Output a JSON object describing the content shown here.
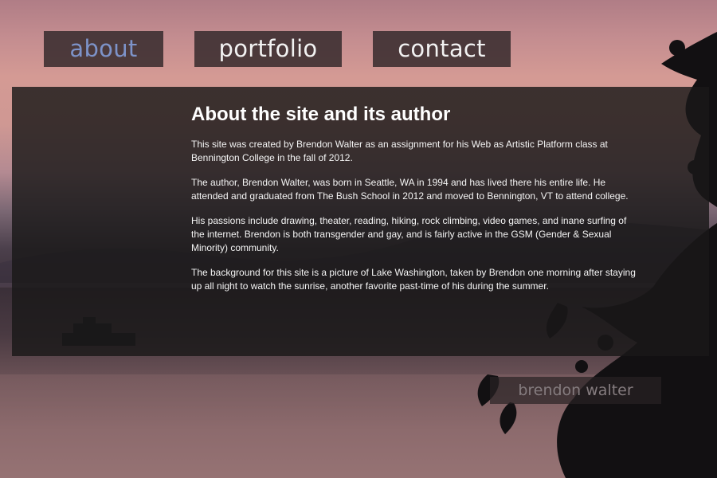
{
  "nav": {
    "tabs": [
      {
        "label": "about",
        "active": true
      },
      {
        "label": "portfolio",
        "active": false
      },
      {
        "label": "contact",
        "active": false
      }
    ]
  },
  "content": {
    "heading": "About the site and its author",
    "paragraphs": [
      "This site was created by Brendon Walter as an assignment for his Web as Artistic Platform class at Bennington College in the fall of 2012.",
      "The author, Brendon Walter, was born in Seattle, WA in 1994 and has lived there his entire life. He attended and graduated from The Bush School in 2012 and moved to Bennington, VT to attend college.",
      "His passions include drawing, theater, reading, hiking, rock climbing, video games, and inane surfing of the internet. Brendon is both transgender and gay, and is fairly active in the GSM (Gender & Sexual Minority) community.",
      "The background for this site is a picture of Lake Washington, taken by Brendon one morning after staying up all night to watch the sunrise, another favorite past-time of his during the summer."
    ]
  },
  "footer": {
    "signature": "brendon walter"
  },
  "colors": {
    "active_tab": "#7d93c9",
    "tab_text": "#f2f2f2",
    "panel_bg": "#1a1818",
    "signature_text": "#857c7f"
  }
}
